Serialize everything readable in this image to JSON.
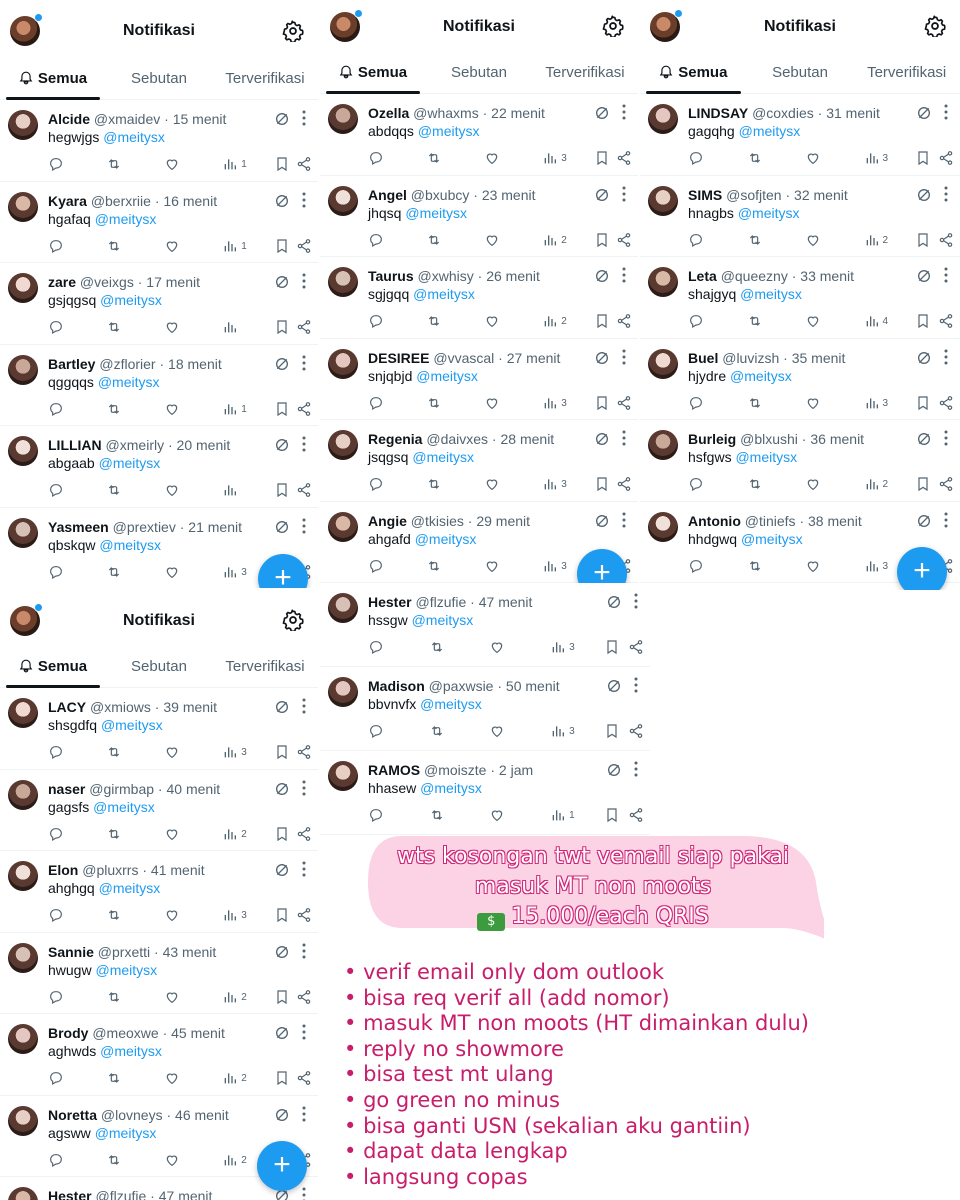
{
  "header": {
    "title": "Notifikasi"
  },
  "tabs": [
    "Semua",
    "Sebutan",
    "Terverifikasi"
  ],
  "mention": "@meitysx",
  "fab_label": "+",
  "panels": [
    {
      "rows": [
        {
          "name": "Alcide",
          "handle": "@xmaidev",
          "time": "15 menit",
          "text": "hegwjgs",
          "views": "1"
        },
        {
          "name": "Kyara",
          "handle": "@berxriie",
          "time": "16 menit",
          "text": "hgafaq",
          "views": "1"
        },
        {
          "name": "zare",
          "handle": "@veixgs",
          "time": "17 menit",
          "text": "gsjqgsq",
          "views": ""
        },
        {
          "name": "Bartley",
          "handle": "@zflorier",
          "time": "18 menit",
          "text": "qggqqs",
          "views": "1"
        },
        {
          "name": "LILLIAN",
          "handle": "@xmeirly",
          "time": "20 menit",
          "text": "abgaab",
          "views": ""
        },
        {
          "name": "Yasmeen",
          "handle": "@prextiev",
          "time": "21 menit",
          "text": "qbskqw",
          "views": "3"
        }
      ]
    },
    {
      "rows": [
        {
          "name": "Ozella",
          "handle": "@whaxms",
          "time": "22 menit",
          "text": "abdqqs",
          "views": "3"
        },
        {
          "name": "Angel",
          "handle": "@bxubcy",
          "time": "23 menit",
          "text": "jhqsq",
          "views": "2"
        },
        {
          "name": "Taurus",
          "handle": "@xwhisy",
          "time": "26 menit",
          "text": "sgjgqq",
          "views": "2"
        },
        {
          "name": "DESIREE",
          "handle": "@vvascal",
          "time": "27 menit",
          "text": "snjqbjd",
          "views": "3"
        },
        {
          "name": "Regenia",
          "handle": "@daivxes",
          "time": "28 menit",
          "text": "jsqgsq",
          "views": "3"
        },
        {
          "name": "Angie",
          "handle": "@tkisies",
          "time": "29 menit",
          "text": "ahgafd",
          "views": "3"
        }
      ]
    },
    {
      "rows": [
        {
          "name": "LINDSAY",
          "handle": "@coxdies",
          "time": "31 menit",
          "text": "gagqhg",
          "views": "3"
        },
        {
          "name": "SIMS",
          "handle": "@sofjten",
          "time": "32 menit",
          "text": "hnagbs",
          "views": "2"
        },
        {
          "name": "Leta",
          "handle": "@queezny",
          "time": "33 menit",
          "text": "shajgyq",
          "views": "4"
        },
        {
          "name": "Buel",
          "handle": "@luvizsh",
          "time": "35 menit",
          "text": "hjydre",
          "views": "3"
        },
        {
          "name": "Burleig",
          "handle": "@blxushi",
          "time": "36 menit",
          "text": "hsfgws",
          "views": "2"
        },
        {
          "name": "Antonio",
          "handle": "@tiniefs",
          "time": "38 menit",
          "text": "hhdgwq",
          "views": "3"
        }
      ]
    },
    {
      "rows": [
        {
          "name": "LACY",
          "handle": "@xmiows",
          "time": "39 menit",
          "text": "shsgdfq",
          "views": "3"
        },
        {
          "name": "naser",
          "handle": "@girmbap",
          "time": "40 menit",
          "text": "gagsfs",
          "views": "2"
        },
        {
          "name": "Elon",
          "handle": "@pluxrrs",
          "time": "41 menit",
          "text": "ahghgq",
          "views": "3"
        },
        {
          "name": "Sannie",
          "handle": "@prxetti",
          "time": "43 menit",
          "text": "hwugw",
          "views": "2"
        },
        {
          "name": "Brody",
          "handle": "@meoxwe",
          "time": "45 menit",
          "text": "aghwds",
          "views": "2"
        },
        {
          "name": "Noretta",
          "handle": "@lovneys",
          "time": "46 menit",
          "text": "agsww",
          "views": "2"
        },
        {
          "name": "Hester",
          "handle": "@flzufie",
          "time": "47 menit",
          "text": "",
          "views": ""
        }
      ]
    },
    {
      "rows": [
        {
          "name": "Hester",
          "handle": "@flzufie",
          "time": "47 menit",
          "text": "hssgw",
          "views": "3"
        },
        {
          "name": "Madison",
          "handle": "@paxwsie",
          "time": "50 menit",
          "text": "bbvnvfx",
          "views": "3"
        },
        {
          "name": "RAMOS",
          "handle": "@moiszte",
          "time": "2 jam",
          "text": "hhasew",
          "views": "1"
        }
      ]
    }
  ],
  "promo": {
    "bubble_lines": [
      "wts kosongan twt vemail siap pakai",
      "masuk MT non moots",
      "15.000/each QRIS"
    ],
    "money_icon": "💵",
    "bullets": [
      "verif email only dom outlook",
      "bisa req verif all (add nomor)",
      "masuk MT non moots (HT dimainkan dulu)",
      "reply no showmore",
      "bisa test mt ulang",
      "go green no minus",
      "bisa ganti USN (sekalian aku gantiin)",
      "dapat data lengkap",
      "langsung copas"
    ],
    "colors": {
      "bubble": "#fbd3e4",
      "text": "#c81d6b",
      "accent": "#1d9bf0"
    }
  }
}
